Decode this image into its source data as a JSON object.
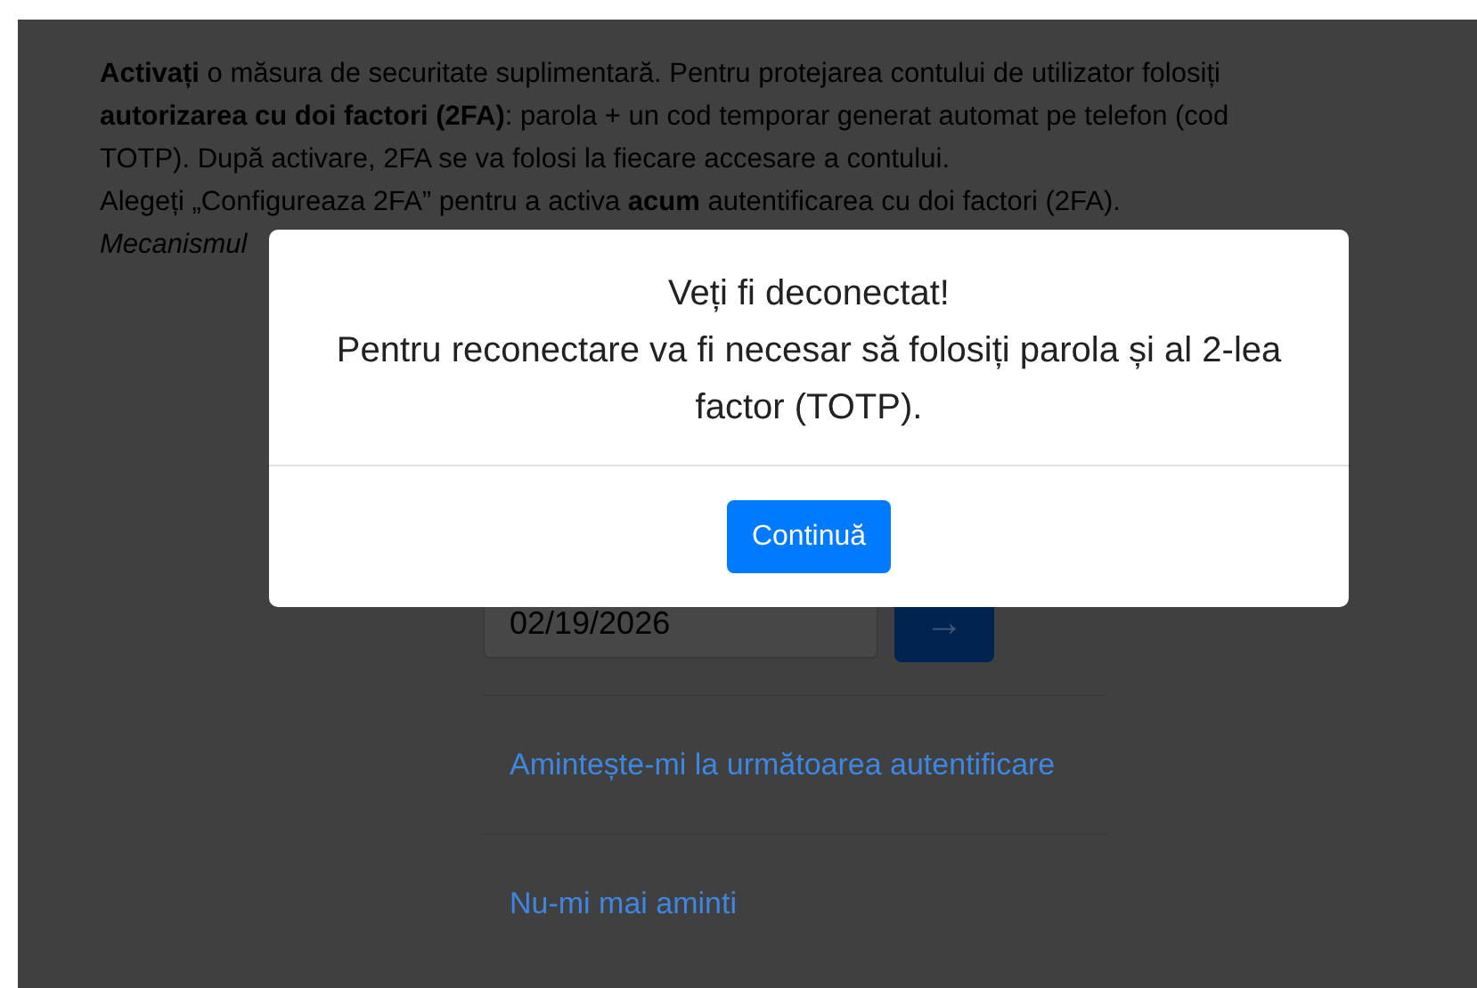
{
  "page": {
    "intro": "**Activați** o măsura de securitate suplimentară. Pentru protejarea contului de utilizator folosiți **autorizarea cu doi factori (2FA)**: parola + un cod temporar generat automat pe telefon (cod TOTP). După activare, 2FA se va folosi la fiecare accesare a contului.",
    "instruction": "Alegeți „Configureaza 2FA” pentru a activa **acum** autentificarea cu doi factori (2FA).",
    "note": "Mecanismul",
    "date_field": {
      "value": "02/19/2026"
    },
    "submit_button": "→",
    "links": [
      "Amintește-mi la următoarea autentificare",
      "Nu-mi mai aminti"
    ]
  },
  "modal": {
    "title": "Veți fi deconectat!",
    "message": "Pentru reconectare va fi necesar să folosiți parola și al 2-lea factor (TOTP).",
    "button": "Continuă"
  }
}
